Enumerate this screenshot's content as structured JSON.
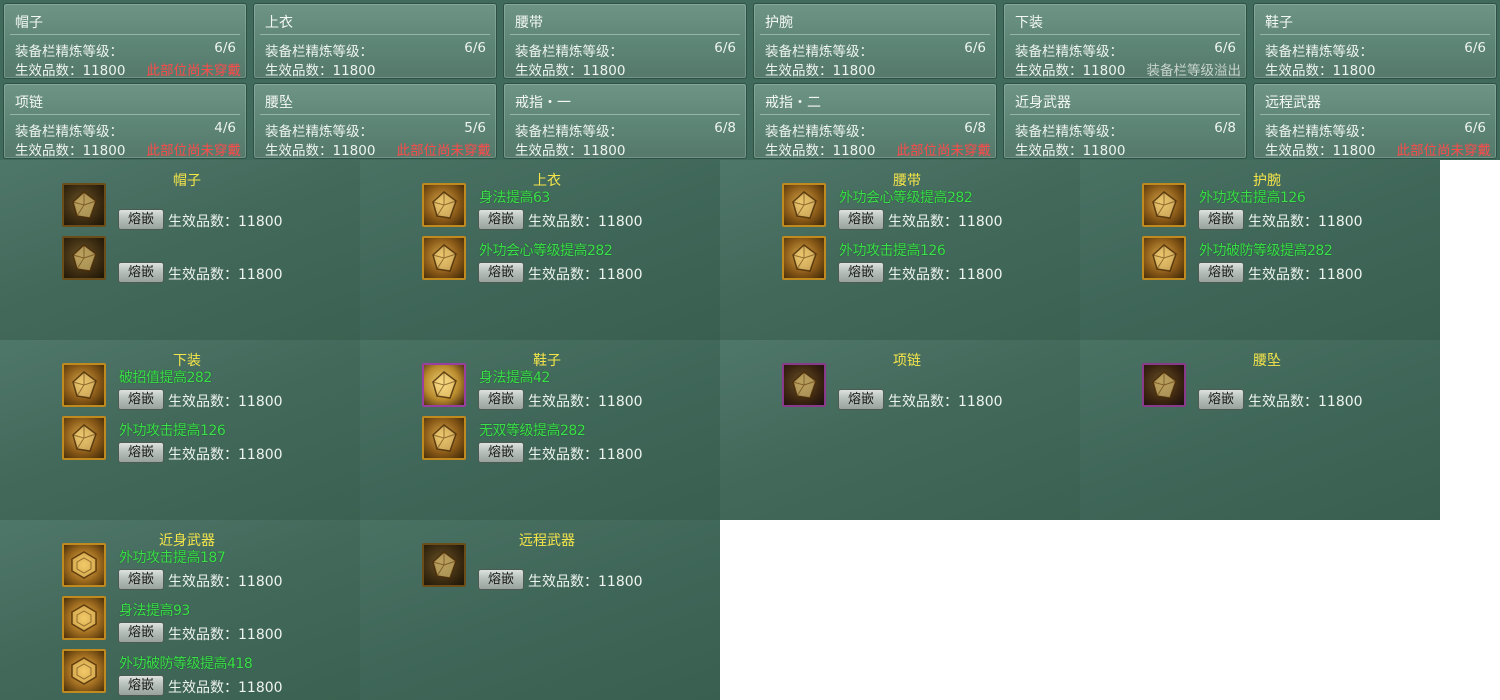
{
  "summary": {
    "label": "装备栏精炼等级：",
    "value_prefix": "生效品数：",
    "cards": [
      {
        "title": "帽子",
        "level": "6/6",
        "value": "11800",
        "note": "此部位尚未穿戴",
        "note_type": "warn"
      },
      {
        "title": "上衣",
        "level": "6/6",
        "value": "11800",
        "note": "",
        "note_type": ""
      },
      {
        "title": "腰带",
        "level": "6/6",
        "value": "11800",
        "note": "",
        "note_type": ""
      },
      {
        "title": "护腕",
        "level": "6/6",
        "value": "11800",
        "note": "",
        "note_type": ""
      },
      {
        "title": "下装",
        "level": "6/6",
        "value": "11800",
        "note": "装备栏等级溢出",
        "note_type": "over"
      },
      {
        "title": "鞋子",
        "level": "6/6",
        "value": "11800",
        "note": "",
        "note_type": ""
      },
      {
        "title": "项链",
        "level": "4/6",
        "value": "11800",
        "note": "此部位尚未穿戴",
        "note_type": "warn"
      },
      {
        "title": "腰坠",
        "level": "5/6",
        "value": "11800",
        "note": "此部位尚未穿戴",
        "note_type": "warn"
      },
      {
        "title": "戒指・一",
        "level": "6/8",
        "value": "11800",
        "note": "",
        "note_type": ""
      },
      {
        "title": "戒指・二",
        "level": "6/8",
        "value": "11800",
        "note": "此部位尚未穿戴",
        "note_type": "warn"
      },
      {
        "title": "近身武器",
        "level": "6/8",
        "value": "11800",
        "note": "",
        "note_type": ""
      },
      {
        "title": "远程武器",
        "level": "6/6",
        "value": "11800",
        "note": "此部位尚未穿戴",
        "note_type": "warn"
      }
    ]
  },
  "inlay": {
    "button_label": "熔嵌",
    "value_text": "生效品数：11800",
    "panels": [
      {
        "title": "帽子",
        "slots": [
          {
            "gem": "",
            "icon": "dark"
          },
          {
            "gem": "",
            "icon": "dark"
          }
        ]
      },
      {
        "title": "上衣",
        "slots": [
          {
            "gem": "身法提高63",
            "icon": "gold"
          },
          {
            "gem": "外功会心等级提高282",
            "icon": "gold"
          }
        ]
      },
      {
        "title": "腰带",
        "slots": [
          {
            "gem": "外功会心等级提高282",
            "icon": "gold"
          },
          {
            "gem": "外功攻击提高126",
            "icon": "gold"
          }
        ]
      },
      {
        "title": "护腕",
        "slots": [
          {
            "gem": "外功攻击提高126",
            "icon": "gold"
          },
          {
            "gem": "外功破防等级提高282",
            "icon": "gold"
          }
        ]
      },
      {
        "title": "下装",
        "slots": [
          {
            "gem": "破招值提高282",
            "icon": "gold"
          },
          {
            "gem": "外功攻击提高126",
            "icon": "gold"
          }
        ]
      },
      {
        "title": "鞋子",
        "slots": [
          {
            "gem": "身法提高42",
            "icon": "purple-bright"
          },
          {
            "gem": "无双等级提高282",
            "icon": "gold"
          }
        ]
      },
      {
        "title": "项链",
        "slots": [
          {
            "gem": "",
            "icon": "purple"
          }
        ]
      },
      {
        "title": "腰坠",
        "slots": [
          {
            "gem": "",
            "icon": "purple"
          }
        ]
      },
      {
        "title": "近身武器",
        "slots": [
          {
            "gem": "外功攻击提高187",
            "icon": "hex"
          },
          {
            "gem": "身法提高93",
            "icon": "hex"
          },
          {
            "gem": "外功破防等级提高418",
            "icon": "hex"
          }
        ]
      },
      {
        "title": "远程武器",
        "slots": [
          {
            "gem": "",
            "icon": "dark"
          }
        ]
      }
    ]
  }
}
